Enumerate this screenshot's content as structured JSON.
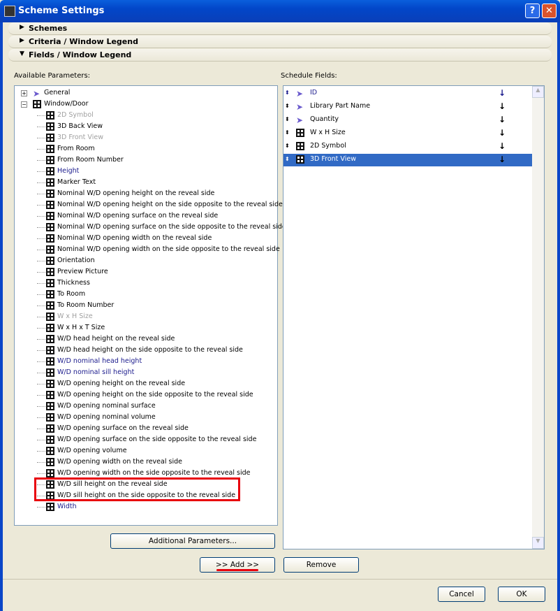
{
  "window": {
    "title": "Scheme Settings",
    "help": "?",
    "close": "✕"
  },
  "sections": [
    {
      "label": "Schemes",
      "expanded": false
    },
    {
      "label": "Criteria /  Window Legend",
      "expanded": false
    },
    {
      "label": "Fields /  Window Legend",
      "expanded": true
    }
  ],
  "available": {
    "label": "Available Parameters:",
    "groups": [
      {
        "label": "General",
        "icon": "cursor-icon",
        "expanded": false
      },
      {
        "label": "Window/Door",
        "icon": "window-icon",
        "expanded": true
      }
    ],
    "items": [
      {
        "label": "2D Symbol",
        "state": "disabled"
      },
      {
        "label": "3D Back View",
        "state": "normal"
      },
      {
        "label": "3D Front View",
        "state": "disabled"
      },
      {
        "label": "From Room",
        "state": "normal"
      },
      {
        "label": "From Room Number",
        "state": "normal"
      },
      {
        "label": "Height",
        "state": "highlight"
      },
      {
        "label": "Marker Text",
        "state": "normal"
      },
      {
        "label": "Nominal W/D opening height on the reveal side",
        "state": "normal"
      },
      {
        "label": "Nominal W/D opening height on the side opposite to the reveal side",
        "state": "normal"
      },
      {
        "label": "Nominal W/D opening surface on the reveal side",
        "state": "normal"
      },
      {
        "label": "Nominal W/D opening surface on the side opposite to the reveal side",
        "state": "normal"
      },
      {
        "label": "Nominal W/D opening width on the reveal side",
        "state": "normal"
      },
      {
        "label": "Nominal W/D opening width on the side opposite to the reveal side",
        "state": "normal"
      },
      {
        "label": "Orientation",
        "state": "normal"
      },
      {
        "label": "Preview Picture",
        "state": "normal"
      },
      {
        "label": "Thickness",
        "state": "normal"
      },
      {
        "label": "To Room",
        "state": "normal"
      },
      {
        "label": "To Room Number",
        "state": "normal"
      },
      {
        "label": "W x H Size",
        "state": "disabled"
      },
      {
        "label": "W x H x T Size",
        "state": "normal"
      },
      {
        "label": "W/D head height on the reveal side",
        "state": "normal"
      },
      {
        "label": "W/D head height on the side opposite to the reveal side",
        "state": "normal"
      },
      {
        "label": "W/D nominal head height",
        "state": "highlight"
      },
      {
        "label": "W/D nominal sill height",
        "state": "highlight"
      },
      {
        "label": "W/D opening height on the reveal side",
        "state": "normal"
      },
      {
        "label": "W/D opening height on the side opposite to the reveal side",
        "state": "normal"
      },
      {
        "label": "W/D opening nominal surface",
        "state": "normal"
      },
      {
        "label": "W/D opening nominal volume",
        "state": "normal"
      },
      {
        "label": "W/D opening surface on the reveal side",
        "state": "normal"
      },
      {
        "label": "W/D opening surface on the side opposite to the reveal side",
        "state": "normal"
      },
      {
        "label": "W/D opening volume",
        "state": "normal"
      },
      {
        "label": "W/D opening width on the reveal side",
        "state": "normal"
      },
      {
        "label": "W/D opening width on the side opposite to the reveal side",
        "state": "normal"
      },
      {
        "label": "W/D sill height on the reveal side",
        "state": "normal"
      },
      {
        "label": "W/D sill height on the side opposite to the reveal side",
        "state": "normal"
      },
      {
        "label": "Width",
        "state": "highlight"
      }
    ]
  },
  "schedule": {
    "label": "Schedule Fields:",
    "items": [
      {
        "label": "ID",
        "icon": "cursor-icon",
        "state": "highlight"
      },
      {
        "label": "Library Part Name",
        "icon": "cursor-icon",
        "state": "normal"
      },
      {
        "label": "Quantity",
        "icon": "cursor-icon",
        "state": "normal"
      },
      {
        "label": "W x H Size",
        "icon": "window-icon",
        "state": "normal"
      },
      {
        "label": "2D Symbol",
        "icon": "window-icon",
        "state": "normal"
      },
      {
        "label": "3D Front View",
        "icon": "window-icon",
        "state": "selected"
      }
    ]
  },
  "buttons": {
    "additional": "Additional Parameters...",
    "add": ">> Add >>",
    "remove": "Remove",
    "cancel": "Cancel",
    "ok": "OK"
  },
  "colors": {
    "annotation": "#e8000d",
    "selection": "#316ac5"
  }
}
